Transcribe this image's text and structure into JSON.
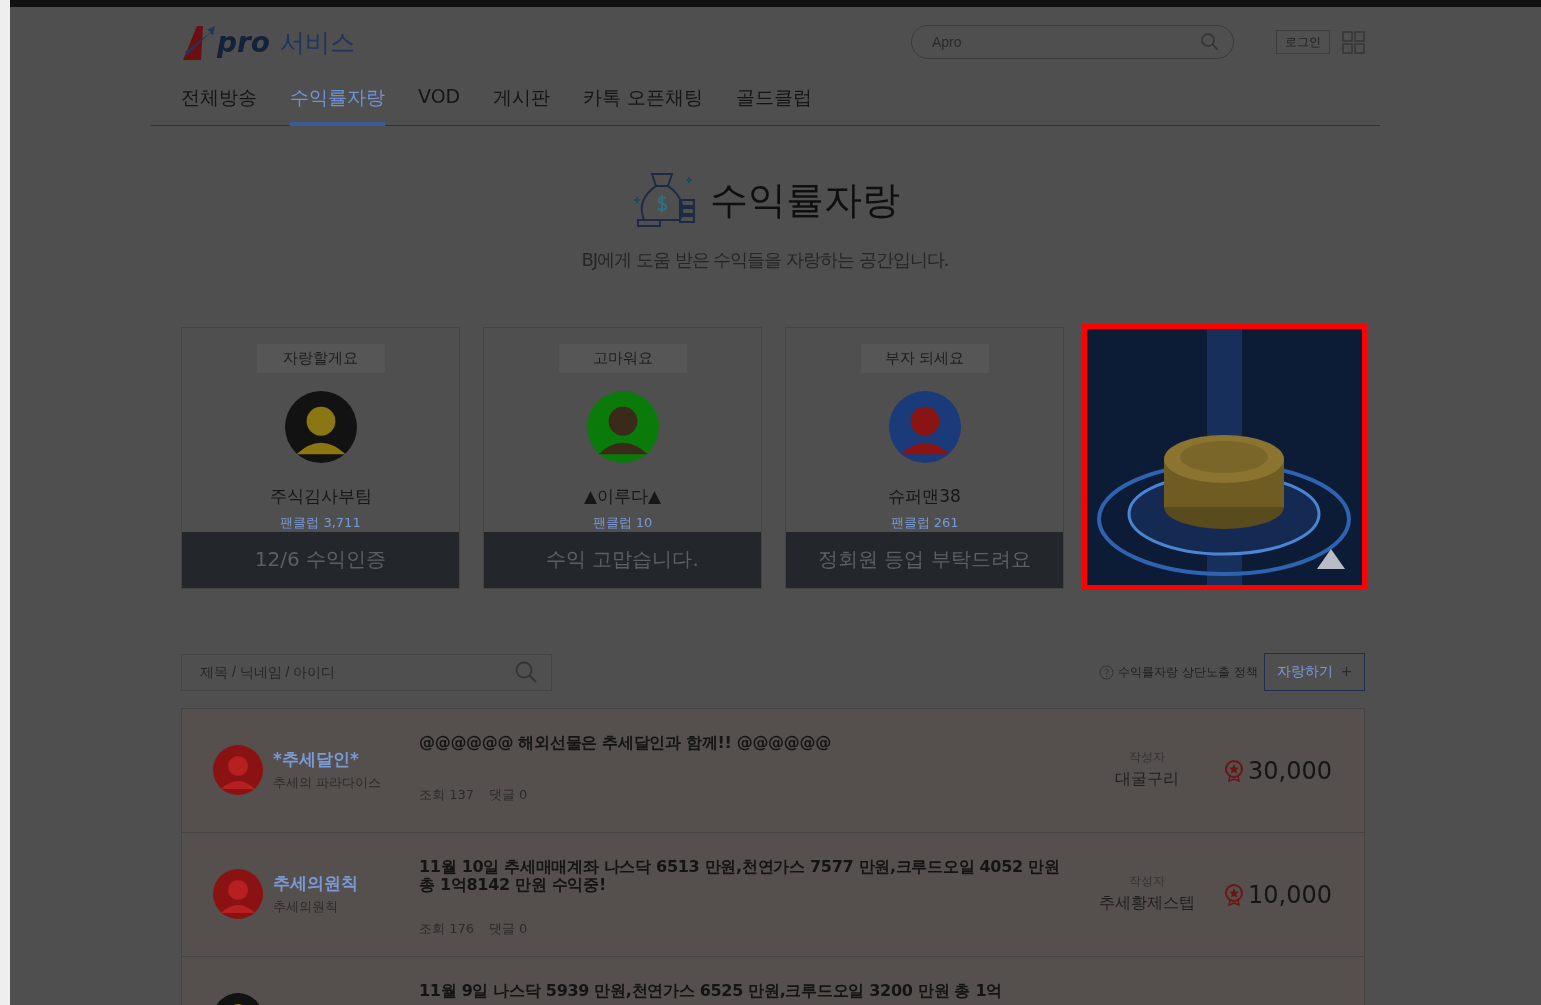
{
  "header": {
    "logo": "pro",
    "service": "서비스",
    "search": {
      "value": "Apro"
    },
    "login": "로그인"
  },
  "nav": [
    {
      "label": "전체방송",
      "selected": false
    },
    {
      "label": "수익률자랑",
      "selected": true
    },
    {
      "label": "VOD",
      "selected": false
    },
    {
      "label": "게시판",
      "selected": false
    },
    {
      "label": "카톡 오픈채팅",
      "selected": false
    },
    {
      "label": "골드클럽",
      "selected": false
    }
  ],
  "hero": {
    "title": "수익률자랑",
    "subtitle": "BJ에게 도움 받은 수익들을 자랑하는 공간입니다."
  },
  "featured": [
    {
      "tag": "자랑할게요",
      "name": "주식김사부팀",
      "fanclub": "팬클럽 3,711",
      "caption": "12/6 수익인증"
    },
    {
      "tag": "고마워요",
      "name": "▲이루다▲",
      "fanclub": "팬클럽 10",
      "caption": "수익 고맙습니다."
    },
    {
      "tag": "부자 되세요",
      "name": "슈퍼맨38",
      "fanclub": "팬클럽 261",
      "caption": "정회원 등업 부탁드려요"
    }
  ],
  "ad": {
    "kind": "picture",
    "highlighted": true
  },
  "toolbar": {
    "search_placeholder": "제목 / 닉네임 / 아이디",
    "policy": "수익률자랑 상단노출 정책",
    "write_button": "자랑하기",
    "plus": "+"
  },
  "posts": [
    {
      "name": "*추세달인*",
      "sub": "추세의 파라다이스",
      "title": "@@@@@@ 해외선물은 추세달인과 함께!! @@@@@@",
      "views": "조회 137",
      "comments": "댓글 0",
      "author_label": "작성자",
      "author": "대굴구리",
      "amount": "30,000"
    },
    {
      "name": "추세의원칙",
      "sub": "추세의원칙",
      "title": "11월 10일 추세매매계좌 나스닥 6513 만원,천연가스 7577 만원,크루드오일 4052 만원 총 1억8142 만원 수익중!",
      "views": "조회 176",
      "comments": "댓글 0",
      "author_label": "작성자",
      "author": "추세황제스텝",
      "amount": "10,000"
    },
    {
      "title": "11월 9일 나스닥 5939 만원,천연가스 6525 만원,크루드오일 3200 만원 총 1억"
    }
  ]
}
